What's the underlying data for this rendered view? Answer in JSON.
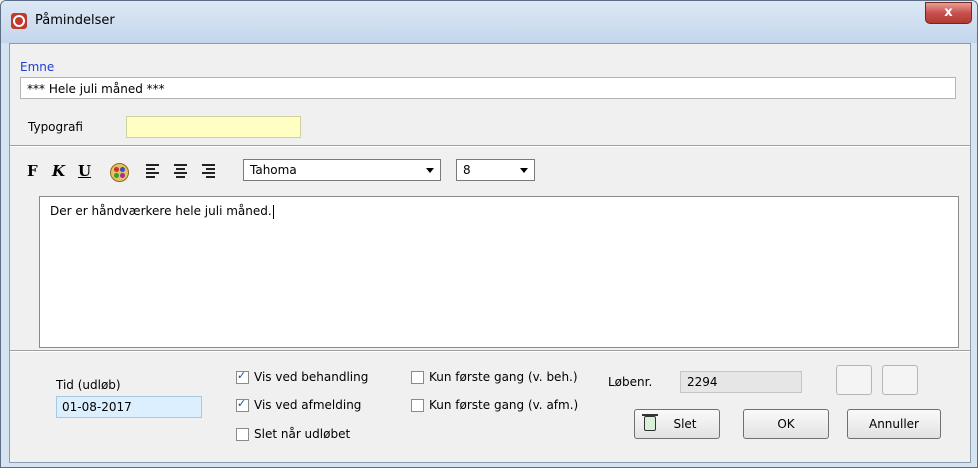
{
  "window": {
    "title": "Påmindelser",
    "close_glyph": "x"
  },
  "form": {
    "emne_label": "Emne",
    "emne_value": "***  Hele juli måned  ***",
    "typografi_label": "Typografi",
    "typografi_value": ""
  },
  "toolbar": {
    "bold_label": "F",
    "italic_label": "K",
    "underline_label": "U",
    "font_name": "Tahoma",
    "font_size": "8"
  },
  "editor": {
    "text": "Der er håndværkere hele juli måned."
  },
  "bottom": {
    "tid_label": "Tid (udløb)",
    "tid_value": "01-08-2017",
    "vis_behandling": {
      "label": "Vis ved behandling",
      "checked": true
    },
    "vis_afmelding": {
      "label": "Vis ved afmelding",
      "checked": true
    },
    "slet_udlobet": {
      "label": "Slet når udløbet",
      "checked": false
    },
    "kun_forste_beh": {
      "label": "Kun første gang (v. beh.)",
      "checked": false
    },
    "kun_forste_afm": {
      "label": "Kun første gang (v. afm.)",
      "checked": false
    },
    "lobenr_label": "Løbenr.",
    "lobenr_value": "2294",
    "slet_button": "Slet",
    "ok_button": "OK",
    "annuller_button": "Annuller"
  }
}
